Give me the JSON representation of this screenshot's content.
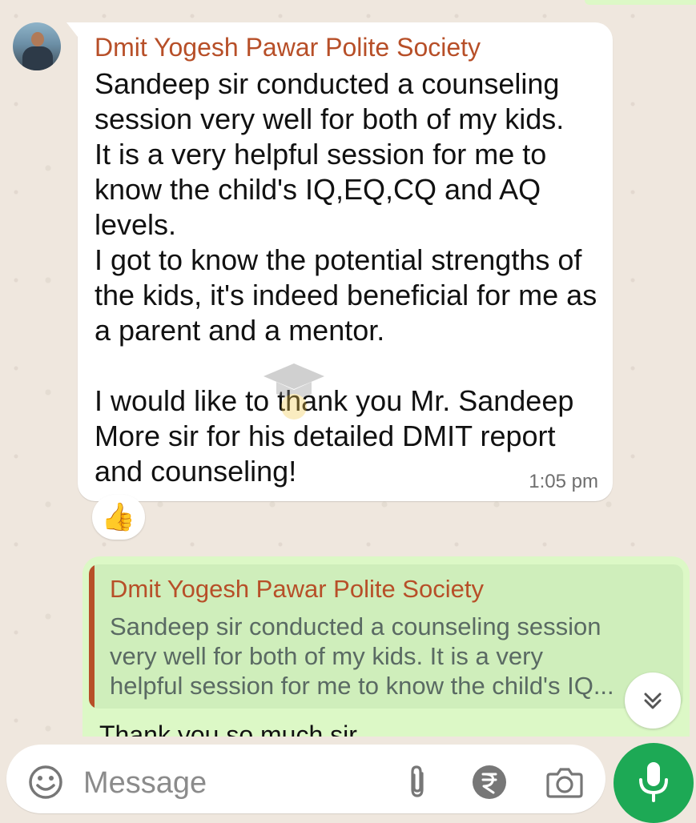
{
  "chat": {
    "incoming": {
      "sender": "Dmit Yogesh Pawar Polite Society",
      "text": "Sandeep sir conducted a counseling session very well for both of my kids.\nIt is a very helpful session for me to know the child's IQ,EQ,CQ and AQ levels.\nI got to know the potential strengths of the kids, it's indeed beneficial for me as a parent and a mentor.\n\nI would like to thank you Mr. Sandeep More sir for his detailed DMIT report and counseling!",
      "time": "1:05 pm",
      "reaction": "👍"
    },
    "outgoing": {
      "quoted_sender": "Dmit Yogesh Pawar Polite Society",
      "quoted_text": "Sandeep sir conducted a counseling session very well for both of my kids.  It is a very helpful session for me to know the child's IQ...",
      "text": "Thank you so much sir"
    }
  },
  "input": {
    "placeholder": "Message"
  },
  "icons": {
    "emoji": "emoji-icon",
    "attach": "paperclip-icon",
    "payment": "rupee-icon",
    "camera": "camera-icon",
    "mic": "mic-icon",
    "scroll": "double-chevron-down-icon"
  },
  "colors": {
    "sender_name": "#b74f28",
    "outgoing_bubble": "#dcf8c6",
    "mic_button": "#1da955",
    "background": "#efe7de"
  }
}
